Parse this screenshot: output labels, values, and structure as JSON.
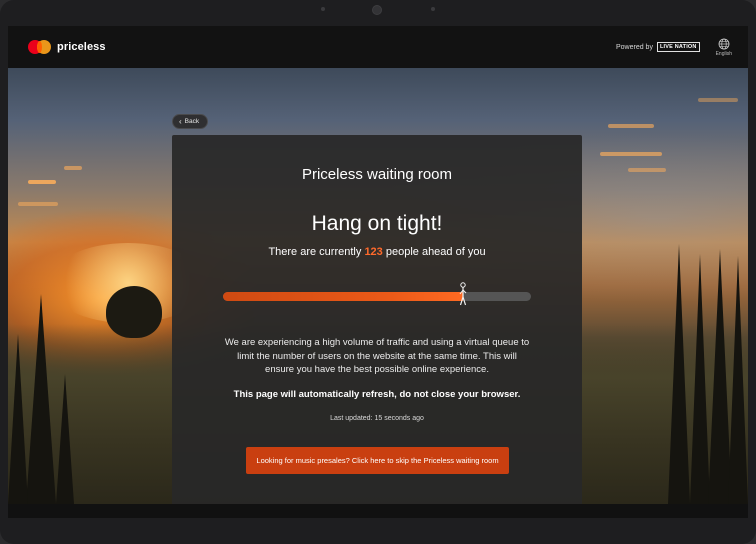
{
  "header": {
    "brand_name": "priceless",
    "powered_by": "Powered by",
    "partner": "LIVE NATION",
    "language": "English"
  },
  "nav": {
    "back_label": "Back"
  },
  "card": {
    "title": "Priceless waiting room",
    "heading": "Hang on tight!",
    "queue_prefix": "There are currently",
    "queue_count": "123",
    "queue_suffix": "people ahead of you",
    "progress_fraction": 0.78,
    "message": "We are experiencing a high volume of traffic and using a virtual queue to limit the number of users on the website at the same time. This will ensure you have the best possible online experience.",
    "refresh_notice": "This page will automatically refresh, do not close your browser.",
    "last_updated": "Last updated: 15 seconds ago",
    "cta_label": "Looking for music presales? Click here to skip the Priceless waiting room"
  },
  "colors": {
    "accent": "#ff6a2b",
    "button": "#c93f10",
    "progress": "#ec5a18",
    "card_bg": "#282828"
  },
  "icons": {
    "logo": "mastercard-circles-icon",
    "language": "globe-icon",
    "back": "chevron-left-icon",
    "progress_marker": "walking-person-icon"
  }
}
